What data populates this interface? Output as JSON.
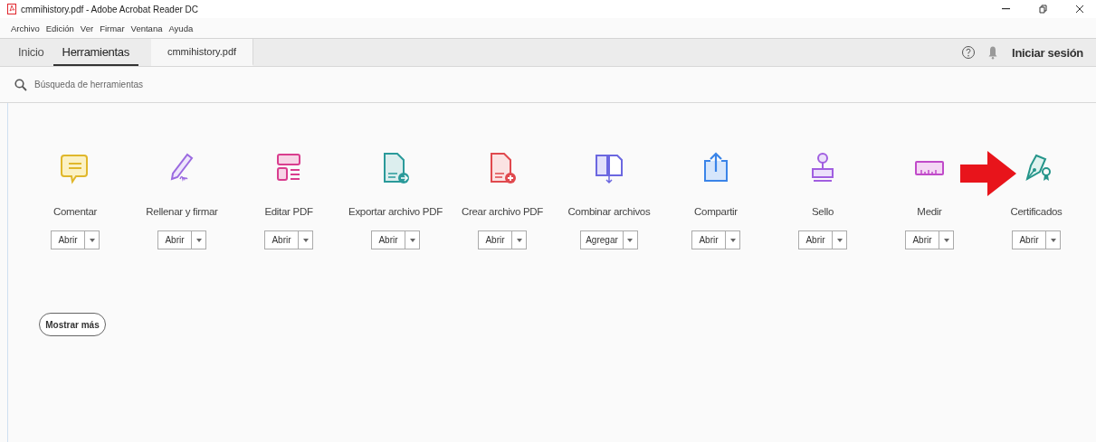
{
  "window": {
    "title": "cmmihistory.pdf - Adobe Acrobat Reader DC"
  },
  "menu": [
    "Archivo",
    "Edición",
    "Ver",
    "Firmar",
    "Ventana",
    "Ayuda"
  ],
  "tabs": [
    {
      "label": "Inicio",
      "kind": "nav",
      "selected": false
    },
    {
      "label": "Herramientas",
      "kind": "nav",
      "selected": true
    },
    {
      "label": "cmmihistory.pdf",
      "kind": "document",
      "selected": false
    }
  ],
  "sign_in": "Iniciar sesión",
  "search": {
    "placeholder": "Búsqueda de herramientas"
  },
  "tools": [
    {
      "kind": "comment",
      "name": "Comentar",
      "action": "Abrir"
    },
    {
      "kind": "fillsign",
      "name": "Rellenar y firmar",
      "action": "Abrir"
    },
    {
      "kind": "edit",
      "name": "Editar PDF",
      "action": "Abrir"
    },
    {
      "kind": "export",
      "name": "Exportar archivo PDF",
      "action": "Abrir"
    },
    {
      "kind": "create",
      "name": "Crear archivo PDF",
      "action": "Abrir"
    },
    {
      "kind": "combine",
      "name": "Combinar archivos",
      "action": "Agregar"
    },
    {
      "kind": "share",
      "name": "Compartir",
      "action": "Abrir"
    },
    {
      "kind": "stamp",
      "name": "Sello",
      "action": "Abrir"
    },
    {
      "kind": "measure",
      "name": "Medir",
      "action": "Abrir"
    },
    {
      "kind": "certificates",
      "name": "Certificados",
      "action": "Abrir"
    }
  ],
  "show_more": "Mostrar más"
}
